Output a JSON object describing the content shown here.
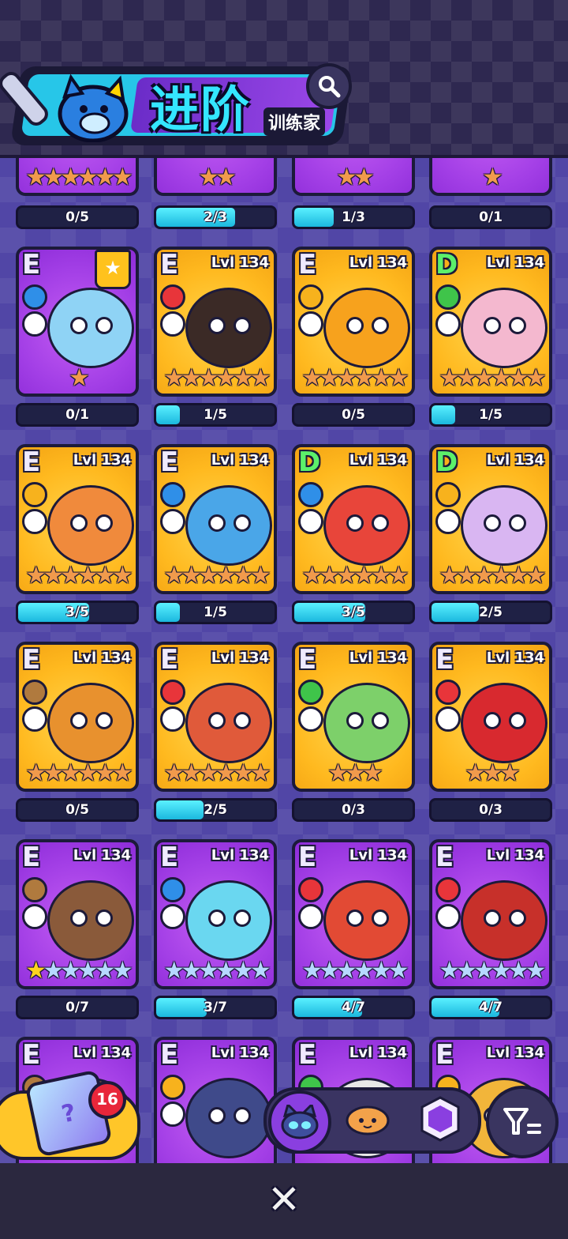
{
  "header": {
    "title": "进阶",
    "subtitle": "训练家",
    "search_icon": "search-icon"
  },
  "colors": {
    "gold_card": "#ffb91f",
    "purple_card": "#a33fe6",
    "progress_fill": "#1bb8de",
    "panel_dark": "#1f2145"
  },
  "rows": [
    {
      "partial": true,
      "cards": [
        {
          "stars": 6,
          "star_color": "orange",
          "bg": "purple",
          "progress": "0/5",
          "fill": 0
        },
        {
          "stars": 2,
          "star_color": "orange",
          "bg": "purple",
          "progress": "2/3",
          "fill": 0.667
        },
        {
          "stars": 2,
          "star_color": "orange",
          "bg": "purple",
          "progress": "1/3",
          "fill": 0.333
        },
        {
          "stars": 1,
          "star_color": "orange",
          "bg": "purple",
          "progress": "0/1",
          "fill": 0
        }
      ]
    },
    {
      "cards": [
        {
          "grade": "E",
          "level": "",
          "bg": "purple",
          "element": "water",
          "stars": 1,
          "star_color": "orange",
          "favorite": true,
          "progress": "0/1",
          "fill": 0,
          "creature": "#8fd3f5"
        },
        {
          "grade": "E",
          "level": "Lvl 134",
          "bg": "gold",
          "element": "fire",
          "stars": 6,
          "star_color": "orange",
          "progress": "1/5",
          "fill": 0.2,
          "creature": "#3b2a26"
        },
        {
          "grade": "E",
          "level": "Lvl 134",
          "bg": "gold",
          "element": "electric",
          "stars": 6,
          "star_color": "orange",
          "progress": "0/5",
          "fill": 0,
          "creature": "#f7a21d"
        },
        {
          "grade": "D",
          "level": "Lvl 134",
          "bg": "gold",
          "element": "grass",
          "stars": 6,
          "star_color": "orange",
          "progress": "1/5",
          "fill": 0.2,
          "creature": "#f4b8cf"
        }
      ]
    },
    {
      "cards": [
        {
          "grade": "E",
          "level": "Lvl 134",
          "bg": "gold",
          "element": "electric",
          "stars": 6,
          "star_color": "orange",
          "progress": "3/5",
          "fill": 0.6,
          "creature": "#f08a3c"
        },
        {
          "grade": "E",
          "level": "Lvl 134",
          "bg": "gold",
          "element": "water",
          "stars": 6,
          "star_color": "orange",
          "progress": "1/5",
          "fill": 0.2,
          "creature": "#4aa6e8"
        },
        {
          "grade": "D",
          "level": "Lvl 134",
          "bg": "gold",
          "element": "water",
          "stars": 6,
          "star_color": "orange",
          "progress": "3/5",
          "fill": 0.6,
          "creature": "#e8453a"
        },
        {
          "grade": "D",
          "level": "Lvl 134",
          "bg": "gold",
          "element": "electric",
          "stars": 6,
          "star_color": "orange",
          "progress": "2/5",
          "fill": 0.4,
          "creature": "#d9b6f2"
        }
      ]
    },
    {
      "cards": [
        {
          "grade": "E",
          "level": "Lvl 134",
          "bg": "gold",
          "element": "rock",
          "stars": 6,
          "star_color": "orange",
          "progress": "0/5",
          "fill": 0,
          "creature": "#e8912e"
        },
        {
          "grade": "E",
          "level": "Lvl 134",
          "bg": "gold",
          "element": "fire",
          "stars": 6,
          "star_color": "orange",
          "progress": "2/5",
          "fill": 0.4,
          "creature": "#e05a3a"
        },
        {
          "grade": "E",
          "level": "Lvl 134",
          "bg": "gold",
          "element": "grass",
          "stars": 3,
          "star_color": "orange",
          "progress": "0/3",
          "fill": 0,
          "creature": "#7dd06a"
        },
        {
          "grade": "E",
          "level": "Lvl 134",
          "bg": "gold",
          "element": "fire",
          "stars": 3,
          "star_color": "orange",
          "progress": "0/3",
          "fill": 0,
          "creature": "#d8292f"
        }
      ]
    },
    {
      "cards": [
        {
          "grade": "E",
          "level": "Lvl 134",
          "bg": "purple",
          "element": "rock",
          "stars": 6,
          "star_color": "blue",
          "first_gold": true,
          "progress": "0/7",
          "fill": 0,
          "creature": "#8a5a3a"
        },
        {
          "grade": "E",
          "level": "Lvl 134",
          "bg": "purple",
          "element": "water",
          "stars": 6,
          "star_color": "blue",
          "progress": "3/7",
          "fill": 0.429,
          "creature": "#6ad7f0"
        },
        {
          "grade": "E",
          "level": "Lvl 134",
          "bg": "purple",
          "element": "fire",
          "stars": 6,
          "star_color": "blue",
          "progress": "4/7",
          "fill": 0.571,
          "creature": "#e24a34"
        },
        {
          "grade": "E",
          "level": "Lvl 134",
          "bg": "purple",
          "element": "fire",
          "stars": 6,
          "star_color": "blue",
          "progress": "4/7",
          "fill": 0.571,
          "creature": "#c7302a"
        }
      ]
    },
    {
      "partial_bottom": true,
      "cards": [
        {
          "grade": "E",
          "level": "Lvl 134",
          "bg": "purple",
          "element": "rock",
          "creature": "#8a5a3a"
        },
        {
          "grade": "E",
          "level": "Lvl 134",
          "bg": "purple",
          "element": "electric",
          "creature": "#3f4a8a"
        },
        {
          "grade": "E",
          "level": "Lvl 134",
          "bg": "purple",
          "element": "grass",
          "creature": "#e8e8e8"
        },
        {
          "grade": "E",
          "level": "Lvl 134",
          "bg": "purple",
          "element": "electric",
          "creature": "#f2b53a"
        }
      ]
    }
  ],
  "bottom": {
    "gacha_count": "16",
    "gacha_icon": "mystery-cube-icon",
    "tabs": [
      {
        "name": "cat-mask-tab",
        "active": true
      },
      {
        "name": "bread-tab",
        "active": false
      },
      {
        "name": "crystal-cat-tab",
        "active": false
      }
    ],
    "filter_icon": "filter-sort-icon",
    "close_label": "✕"
  }
}
